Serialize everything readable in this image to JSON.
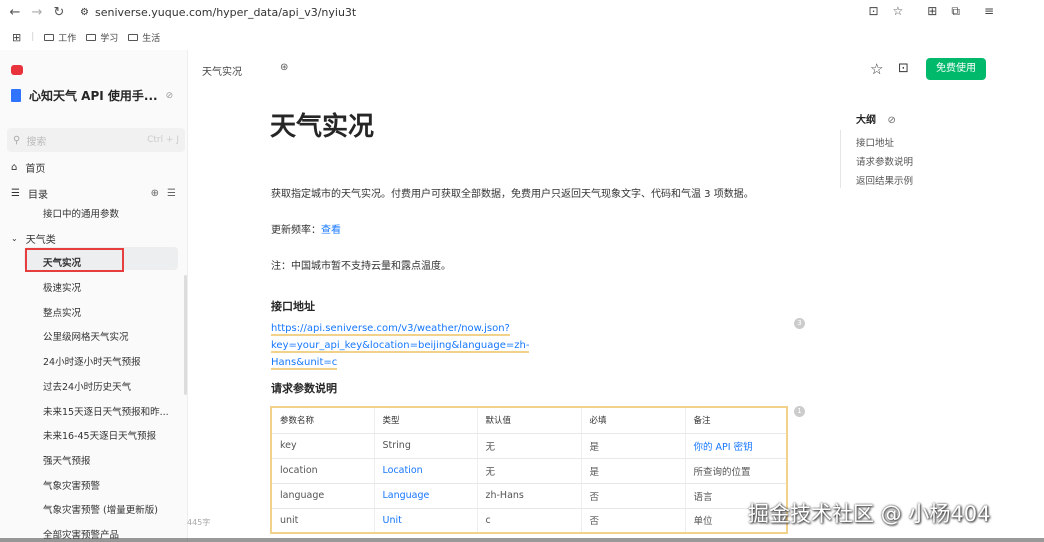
{
  "browser": {
    "url": "seniverse.yuque.com/hyper_data/api_v3/nyiu3t",
    "bookmarks": [
      "工作",
      "学习",
      "生活"
    ]
  },
  "sidebar": {
    "book_title": "心知天气 API 使用手...",
    "search_placeholder": "搜索",
    "search_shortcut": "Ctrl + J",
    "home": "首页",
    "toc": "目录",
    "items": [
      "接口中的通用参数",
      "天气类",
      "天气实况",
      "极速实况",
      "整点实况",
      "公里级网格天气实况",
      "24小时逐小时天气预报",
      "过去24小时历史天气",
      "未来15天逐日天气预报和昨...",
      "未来16-45天逐日天气预报",
      "强天气预报",
      "气象灾害预警",
      "气象灾害预警 (增量更新版)",
      "全部灾害预警产品"
    ],
    "word_count": "445字"
  },
  "topbar": {
    "breadcrumb": "天气实况",
    "free_button": "免费使用"
  },
  "content": {
    "title": "天气实况",
    "intro": "获取指定城市的天气实况。付费用户可获取全部数据，免费用户只返回天气现象文字、代码和气温 3 项数据。",
    "update_label": "更新频率：",
    "update_link": "查看",
    "note": "注：中国城市暂不支持云量和露点温度。",
    "api_heading": "接口地址",
    "api_url_line1": "https://api.seniverse.com/v3/weather/now.json?key=your_api_key&location=beijing&language=zh-",
    "api_url_line2": "Hans&unit=c",
    "params_heading": "请求参数说明",
    "comment_count_1": "3",
    "comment_count_2": "1",
    "table": {
      "headers": [
        "参数名称",
        "类型",
        "默认值",
        "必填",
        "备注"
      ],
      "rows": [
        [
          "key",
          "String",
          "无",
          "是",
          "你的 API 密钥"
        ],
        [
          "location",
          "Location",
          "无",
          "是",
          "所查询的位置"
        ],
        [
          "language",
          "Language",
          "zh-Hans",
          "否",
          "语言"
        ],
        [
          "unit",
          "Unit",
          "c",
          "否",
          "单位"
        ]
      ]
    }
  },
  "outline": {
    "title": "大纲",
    "items": [
      "接口地址",
      "请求参数说明",
      "返回结果示例"
    ]
  },
  "watermark": "掘金技术社区 @ 小杨404",
  "colors": {
    "accent": "#00b96b",
    "link": "#1677ff",
    "highlight_border": "#e63e3e",
    "table_border": "#f2d18a"
  }
}
